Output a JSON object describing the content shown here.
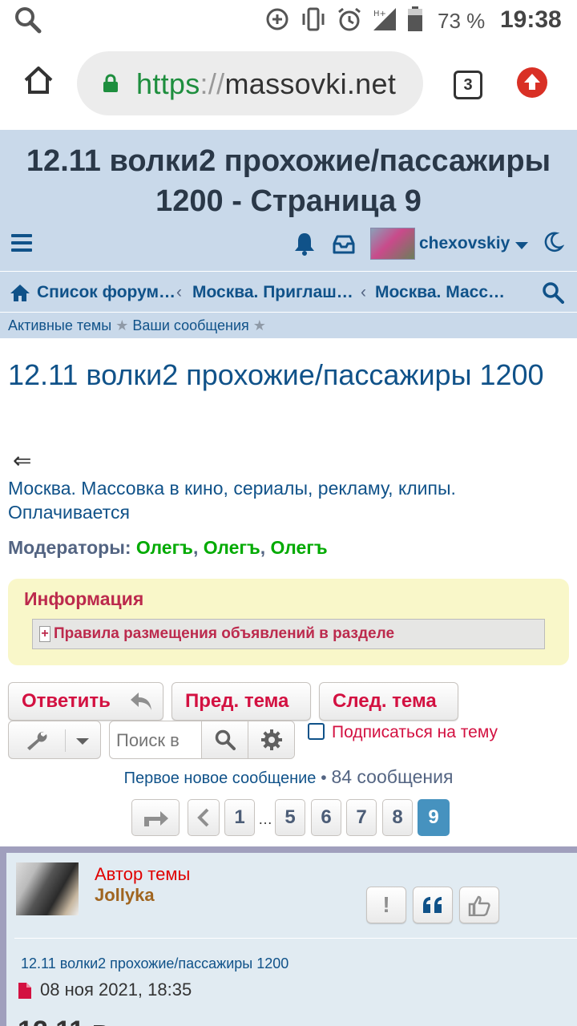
{
  "status_bar": {
    "battery": "73 %",
    "time": "19:38",
    "icons": [
      "search-icon",
      "data-saver-icon",
      "vibrate-icon",
      "alarm-icon",
      "signal-icon",
      "battery-icon"
    ]
  },
  "browser": {
    "url_scheme": "https",
    "url_sep": "://",
    "url_host": "massovki.net",
    "tab_count": "3"
  },
  "header": {
    "title_line1": "12.11 волки2 прохожие/пассажиры",
    "title_line2": "1200 - Страница 9",
    "username": "chexovskiy"
  },
  "breadcrumbs": [
    "Список форум…",
    "Москва. Приглаш…",
    "Москва. Масс…"
  ],
  "subnav": {
    "active_topics": "Активные темы",
    "your_posts": "Ваши сообщения",
    "star": "★"
  },
  "topic": {
    "title": "12.11 волки2 прохожие/пассажиры 1200",
    "back": "⇐",
    "forum_link": "Москва. Массовка в кино, сериалы, рекламу, клипы. Оплачивается",
    "moderators_label": "Модераторы:",
    "moderators": [
      "Олегъ",
      "Олегъ",
      "Олегъ"
    ]
  },
  "info": {
    "title": "Информация",
    "spoiler_plus": "+",
    "spoiler_label": "Правила размещения объявлений в разделе"
  },
  "actions": {
    "reply": "Ответить",
    "prev_topic": "Пред. тема",
    "next_topic": "След. тема",
    "search_placeholder": "Поиск в",
    "subscribe": "Подписаться на тему"
  },
  "pagination": {
    "first_new": "Первое новое сообщение",
    "bullet": " • ",
    "count": "84 сообщения",
    "pages": [
      "1",
      "5",
      "6",
      "7",
      "8",
      "9"
    ],
    "dots": "…",
    "current": "9"
  },
  "post": {
    "author_label": "Автор темы",
    "author_name": "Jollyka",
    "report": "!",
    "subject": "12.11 волки2 прохожие/пассажиры 1200",
    "date": "08 ноя 2021, 18:35"
  },
  "colors": {
    "header_bg": "#c9d9ea",
    "link": "#105289",
    "button_text": "#d31141",
    "moderator": "#00aa00",
    "info_bg": "#f9f7c9",
    "current_page": "#4692bf",
    "post_bg": "#e1ebf2"
  }
}
